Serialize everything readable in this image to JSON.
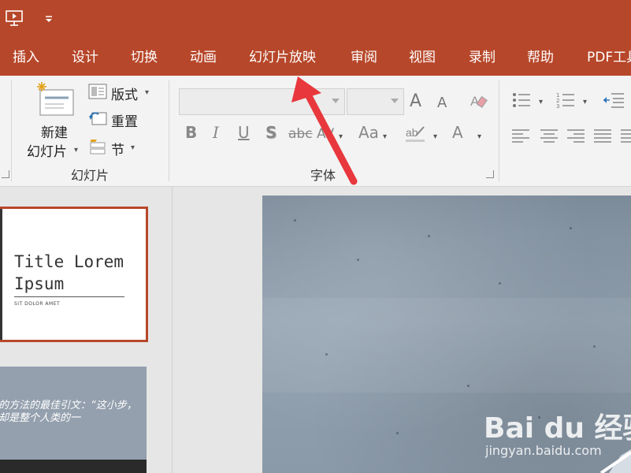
{
  "tabs": [
    "插入",
    "设计",
    "切换",
    "动画",
    "幻灯片放映",
    "审阅",
    "视图",
    "录制",
    "帮助",
    "PDF工具"
  ],
  "ribbon": {
    "slides_group": {
      "new_slide_line1": "新建",
      "new_slide_line2": "幻灯片",
      "layout": "版式",
      "reset": "重置",
      "section": "节",
      "label": "幻灯片"
    },
    "font_group": {
      "label": "字体",
      "grow_font": "A",
      "shrink_font": "A",
      "bold": "B",
      "italic": "I",
      "underline": "U",
      "shadow": "S",
      "strikethrough": "abc",
      "spacing": "AV",
      "change_case": "Aa",
      "font_color": "A"
    }
  },
  "thumbnails": {
    "slide1": {
      "title": "Title Lorem Ipsum",
      "subtitle": "SIT DOLOR AMET"
    },
    "slide2": {
      "quote": "的方法的最佳引文：“这小步，却是整个人类的一"
    }
  },
  "watermark": {
    "logo": "Bai du 经验",
    "url": "jingyan.baidu.com"
  },
  "colors": {
    "accent": "#b7472a",
    "ribbon_bg": "#f3f3f3",
    "arrow": "#e8383d"
  }
}
